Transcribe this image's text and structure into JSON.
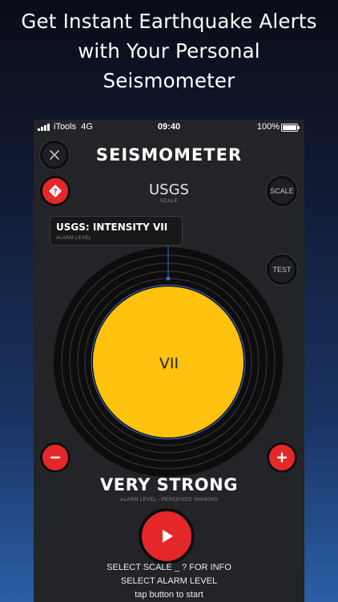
{
  "headline": {
    "lines": [
      "Get Instant Earthquake Alerts",
      "with Your Personal",
      "Seismometer"
    ]
  },
  "status_bar": {
    "carrier": "iTools",
    "network": "4G",
    "time": "09:40",
    "battery": "100%"
  },
  "app": {
    "title": "SEISMOMETER",
    "close_icon": "close-icon",
    "info_icon": "help-diamond-icon",
    "scale": {
      "name": "USGS",
      "caption": "SCALE",
      "button_label": "SCALE"
    },
    "test_button_label": "TEST",
    "alarm_callout": {
      "title": "USGS: INTENSITY VII",
      "caption": "ALARM LEVEL"
    },
    "dial": {
      "value": "VII",
      "fill_color": "#ffc20e",
      "ring_color": "#0d0d0e"
    },
    "decrease_icon": "minus-icon",
    "increase_icon": "plus-icon",
    "strength": {
      "label": "VERY STRONG",
      "caption": "ALARM LEVEL - PERCEIVED SHAKING"
    },
    "start_icon": "play-icon",
    "instructions": [
      "SELECT SCALE _ ? FOR INFO",
      "SELECT ALARM LEVEL",
      "tap button to start"
    ]
  },
  "colors": {
    "accent_red": "#e4282a",
    "intensity_yellow": "#ffc20e",
    "marker_blue": "#3b6fd0"
  }
}
